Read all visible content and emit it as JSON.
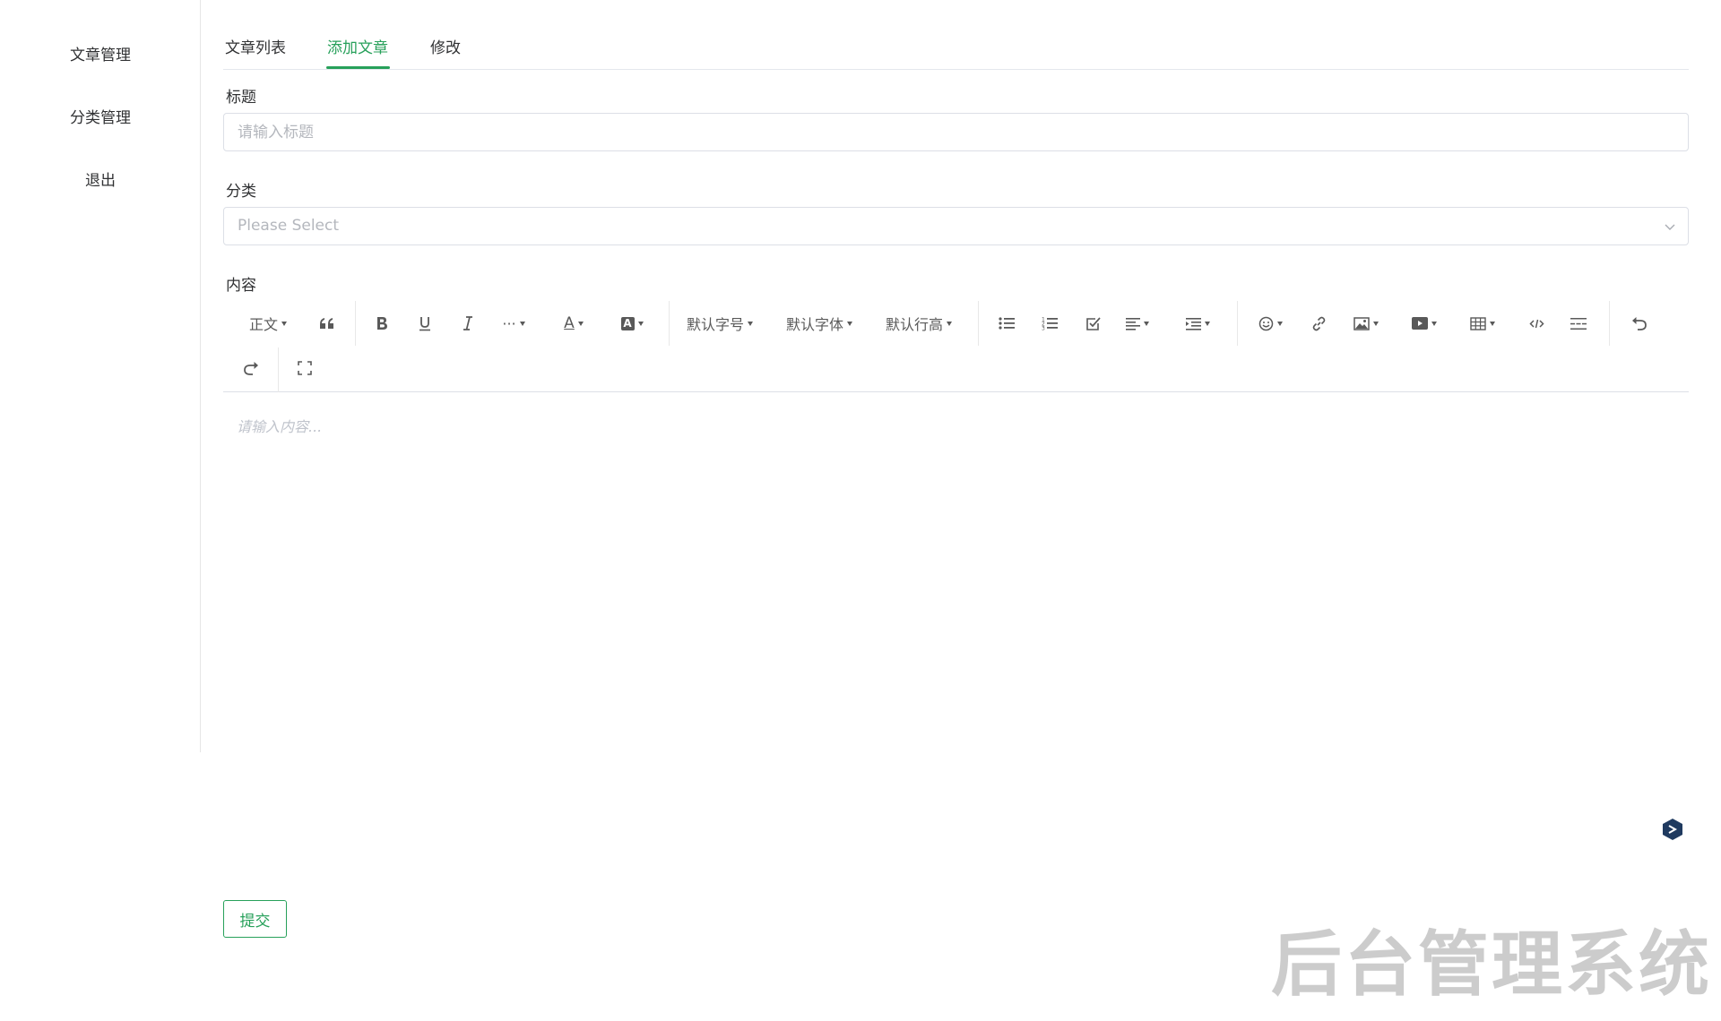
{
  "sidebar": {
    "items": [
      {
        "label": "文章管理"
      },
      {
        "label": "分类管理"
      },
      {
        "label": "退出"
      }
    ]
  },
  "tabs": [
    {
      "label": "文章列表"
    },
    {
      "label": "添加文章"
    },
    {
      "label": "修改"
    }
  ],
  "active_tab": "添加文章",
  "form": {
    "title_label": "标题",
    "title_placeholder": "请输入标题",
    "category_label": "分类",
    "category_placeholder": "Please Select",
    "content_label": "内容",
    "content_placeholder": "请输入内容...",
    "submit_label": "提交"
  },
  "toolbar": {
    "heading": "正文",
    "font_size": "默认字号",
    "font_family": "默认字体",
    "line_height": "默认行高",
    "more": "···",
    "font_color_glyph": "A",
    "bg_color_glyph": "A"
  },
  "watermark": "后台管理系统",
  "colors": {
    "accent": "#27a05a",
    "border": "#dcdfe6",
    "placeholder": "#b4b7bd",
    "watermark": "#cccccc"
  }
}
